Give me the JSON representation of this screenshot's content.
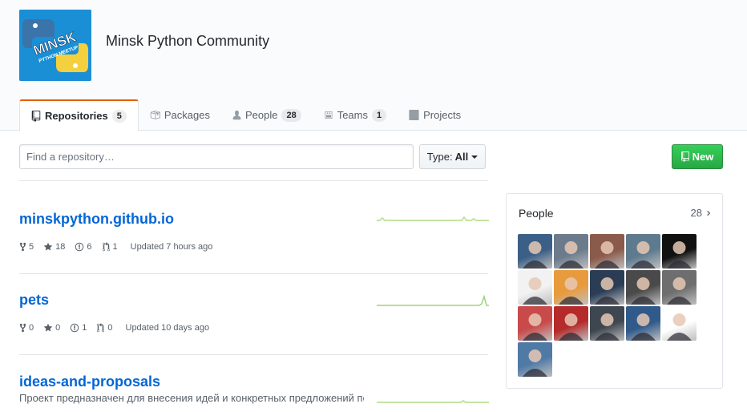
{
  "org": {
    "name": "Minsk Python Community",
    "logo_text_main": "MINSK",
    "logo_text_sub": "PYTHON MEETUP"
  },
  "tabs": [
    {
      "label": "Repositories",
      "count": "5",
      "icon": "repo-icon",
      "selected": true
    },
    {
      "label": "Packages",
      "count": "",
      "icon": "package-icon",
      "selected": false
    },
    {
      "label": "People",
      "count": "28",
      "icon": "person-icon",
      "selected": false
    },
    {
      "label": "Teams",
      "count": "1",
      "icon": "team-icon",
      "selected": false
    },
    {
      "label": "Projects",
      "count": "",
      "icon": "project-icon",
      "selected": false
    }
  ],
  "filter": {
    "search_placeholder": "Find a repository…",
    "type_label": "Type:",
    "type_value": "All",
    "new_label": "New"
  },
  "repos": [
    {
      "name": "minskpython.github.io",
      "description": "",
      "forks": "5",
      "stars": "18",
      "issues": "6",
      "pulls": "1",
      "updated": "Updated 7 hours ago"
    },
    {
      "name": "pets",
      "description": "",
      "forks": "0",
      "stars": "0",
      "issues": "1",
      "pulls": "0",
      "updated": "Updated 10 days ago"
    },
    {
      "name": "ideas-and-proposals",
      "description": "Проект предназначен для внесения идей и конкретных предложений по",
      "forks": "",
      "stars": "",
      "issues": "",
      "pulls": "",
      "updated": ""
    }
  ],
  "people": {
    "title": "People",
    "count": "28",
    "avatar_colors": [
      "#3b5f86",
      "#6b7b8c",
      "#8a5a4a",
      "#5e7a8e",
      "#111111",
      "#f2f2f2",
      "#e89b3c",
      "#2a3d55",
      "#4a4a4a",
      "#6e6e6e",
      "#c94a4a",
      "#b52a2a",
      "#3e4650",
      "#2f5a8a",
      "#ffffff",
      "#4f7aa6"
    ]
  },
  "colors": {
    "accent_tab": "#e36209",
    "link": "#0366d6",
    "new_button": "#28a745",
    "sparkline": "#c2e5a0"
  }
}
